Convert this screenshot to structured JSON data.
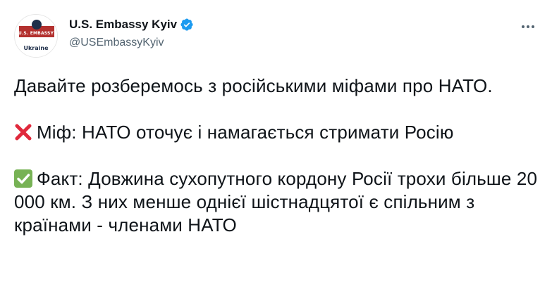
{
  "account": {
    "display_name": "U.S. Embassy Kyiv",
    "handle": "@USEmbassyKyiv",
    "verified": true,
    "avatar": {
      "line1": "U.S. EMBASSY",
      "line2": "Ukraine",
      "colors": {
        "top": "#b3312f",
        "seal": "#1f2f4a"
      }
    }
  },
  "menu": {
    "icon": "more-horizontal-icon",
    "glyph": "···"
  },
  "tweet": {
    "line_intro": "Давайте розберемось з російськими міфами про НАТО.",
    "myth": {
      "icon": "cross-mark-icon",
      "color": "#e0293c",
      "text": "Міф: НАТО оточує і намагається стримати Росію"
    },
    "fact": {
      "icon": "check-mark-icon",
      "color": "#77b255",
      "text": "Факт: Довжина сухопутного кордону Росії трохи більше 20 000 км. З них менше однієї шістнадцятої є спільним з країнами - членами НАТО"
    }
  },
  "colors": {
    "verified_badge": "#1d9bf0",
    "text_primary": "#0f1419",
    "text_secondary": "#536471"
  }
}
